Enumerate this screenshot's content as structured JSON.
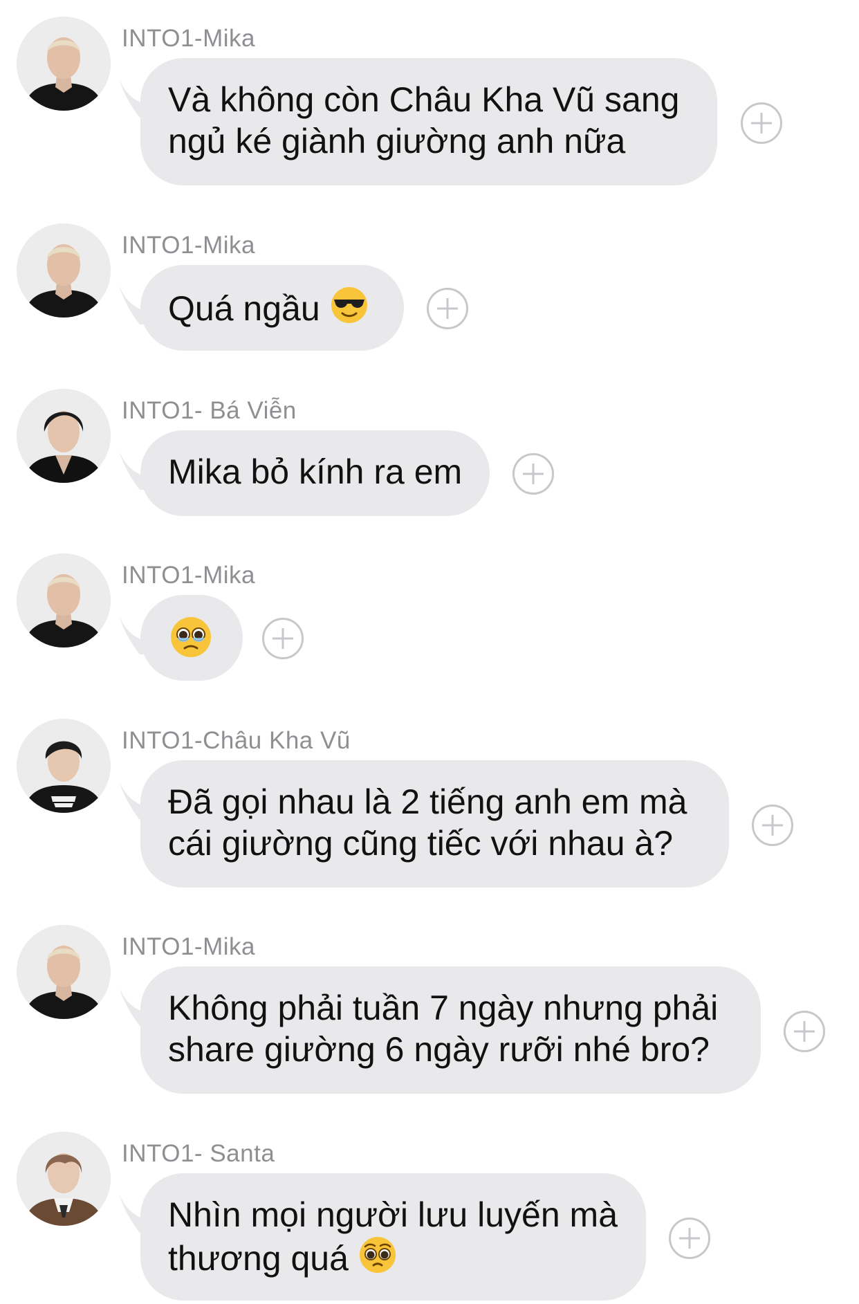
{
  "messages": [
    {
      "sender": "INTO1-Mika",
      "lines": [
        "Và không còn Châu Kha Vũ sang",
        "ngủ ké giành giường anh nữa"
      ],
      "emoji": null
    },
    {
      "sender": "INTO1-Mika",
      "lines": [
        "Quá ngầu "
      ],
      "emoji": "sunglasses-emoji"
    },
    {
      "sender": "INTO1- Bá Viễn",
      "lines": [
        "Mika bỏ kính ra em"
      ],
      "emoji": null
    },
    {
      "sender": "INTO1-Mika",
      "lines": [
        ""
      ],
      "emoji": "holding-back-tears-emoji"
    },
    {
      "sender": "INTO1-Châu Kha Vũ",
      "lines": [
        "Đã gọi nhau là 2 tiếng anh em mà",
        "cái giường cũng tiếc với nhau à?"
      ],
      "emoji": null
    },
    {
      "sender": "INTO1-Mika",
      "lines": [
        "Không phải tuần 7 ngày nhưng phải",
        "share giường 6 ngày rưỡi nhé bro?"
      ],
      "emoji": null
    },
    {
      "sender": "INTO1- Santa",
      "lines": [
        "Nhìn mọi người lưu luyến mà",
        "thương quá "
      ],
      "emoji": "pleading-face-emoji"
    }
  ],
  "icons": {
    "add_reaction": "plus-circle-icon"
  },
  "colors": {
    "bubble": "#e9e9eb",
    "sender": "#8e8e93",
    "text": "#111111",
    "plus": "#c7c7cc"
  }
}
